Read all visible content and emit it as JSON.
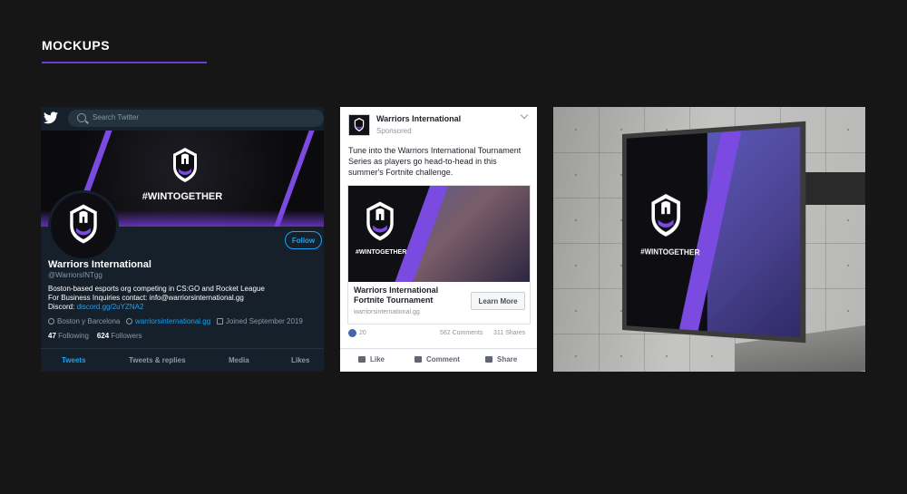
{
  "page": {
    "title": "MOCKUPS"
  },
  "twitter": {
    "search_placeholder": "Search Twitter",
    "banner_tag": "#WINTOGETHER",
    "follow_label": "Follow",
    "name": "Warriors International",
    "handle": "@WarriorsINTgg",
    "bio_line1": "Boston-based esports org competing in CS:GO and Rocket League",
    "bio_line2": "For Business Inquiries contact: info@warriorsinternational.gg",
    "bio_discord_label": "Discord:",
    "bio_discord_link": "discord.gg/2uYZNA2",
    "location": "Boston y Barcelona",
    "website": "warriorsinternational.gg",
    "joined": "Joined September 2019",
    "following_count": "47",
    "following_label": "Following",
    "followers_count": "624",
    "followers_label": "Followers",
    "tabs": [
      "Tweets",
      "Tweets & replies",
      "Media",
      "Likes"
    ],
    "colors": {
      "accent": "#1da1f2",
      "bg": "#15202b",
      "brand": "#7b4ae0"
    }
  },
  "facebook": {
    "page_name": "Warriors International",
    "sponsored": "Sponsored",
    "post_text": "Tune into the Warriors International Tournament Series as players go head-to-head in this summer's Fortnite challenge.",
    "image_tag": "#WINTOGETHER",
    "headline_line1": "Warriors International",
    "headline_line2": "Fortnite Tournament",
    "url": "warriorsinternational.gg",
    "cta_label": "Learn More",
    "reactions": "20",
    "comments": "562 Comments",
    "shares": "311 Shares",
    "actions": [
      "Like",
      "Comment",
      "Share"
    ]
  },
  "billboard": {
    "screen_tag": "#WINTOGETHER"
  }
}
